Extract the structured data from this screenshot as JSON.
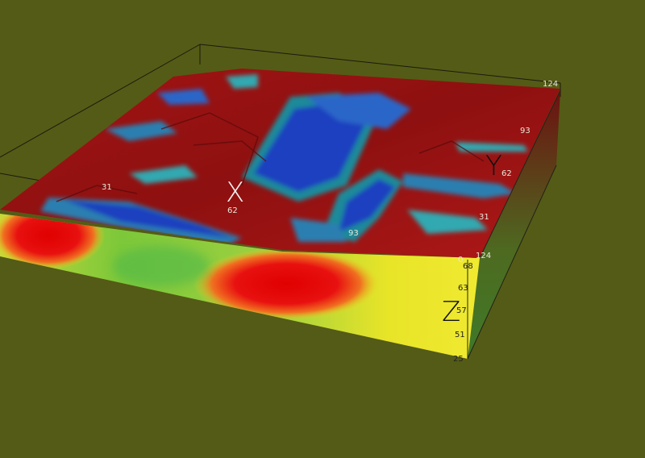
{
  "scene": {
    "background_color": "#545b16",
    "palette": {
      "high": "#b31212",
      "dark_red": "#8a1010",
      "mid_high": "#e8e020",
      "mid": "#5cbf3a",
      "mid_low": "#30a8b0",
      "low": "#1a3fbf"
    }
  },
  "axes": {
    "x": {
      "name": "X",
      "ticks": [
        "31",
        "62",
        "93"
      ]
    },
    "y": {
      "name": "Y",
      "ticks": [
        "0",
        "31",
        "62",
        "93",
        "124"
      ]
    },
    "z": {
      "name": "Z",
      "ticks": [
        "68",
        "63",
        "57",
        "51",
        "25"
      ]
    },
    "x_end_tick": "124"
  }
}
